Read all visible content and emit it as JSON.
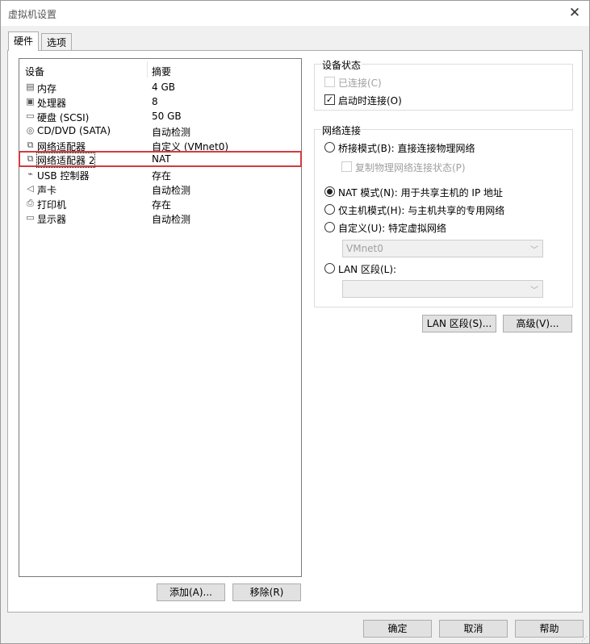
{
  "window": {
    "title": "虚拟机设置"
  },
  "tabs": [
    {
      "label": "硬件"
    },
    {
      "label": "选项"
    }
  ],
  "device_list": {
    "headers": {
      "device": "设备",
      "summary": "摘要"
    },
    "rows": [
      {
        "icon": "memory-icon",
        "name": "内存",
        "summary": "4 GB"
      },
      {
        "icon": "processor-icon",
        "name": "处理器",
        "summary": "8"
      },
      {
        "icon": "hard-disk-icon",
        "name": "硬盘 (SCSI)",
        "summary": "50 GB"
      },
      {
        "icon": "cd-dvd-icon",
        "name": "CD/DVD (SATA)",
        "summary": "自动检测"
      },
      {
        "icon": "network-adapter-icon",
        "name": "网络适配器",
        "summary": "自定义 (VMnet0)"
      },
      {
        "icon": "network-adapter-icon",
        "name": "网络适配器 2",
        "summary": "NAT"
      },
      {
        "icon": "usb-icon",
        "name": "USB 控制器",
        "summary": "存在"
      },
      {
        "icon": "sound-icon",
        "name": "声卡",
        "summary": "自动检测"
      },
      {
        "icon": "printer-icon",
        "name": "打印机",
        "summary": "存在"
      },
      {
        "icon": "display-icon",
        "name": "显示器",
        "summary": "自动检测"
      }
    ],
    "selected_index": 5,
    "highlight_color": "#d23c3c"
  },
  "list_buttons": {
    "add": "添加(A)...",
    "remove": "移除(R)"
  },
  "device_status": {
    "title": "设备状态",
    "connected": {
      "label": "已连接(C)",
      "checked": false,
      "enabled": false
    },
    "connect_at_power_on": {
      "label": "启动时连接(O)",
      "checked": true,
      "enabled": true
    }
  },
  "network": {
    "title": "网络连接",
    "bridged": {
      "label": "桥接模式(B): 直接连接物理网络",
      "selected": false
    },
    "replicate": {
      "label": "复制物理网络连接状态(P)",
      "checked": false,
      "enabled": false
    },
    "nat": {
      "label": "NAT 模式(N): 用于共享主机的 IP 地址",
      "selected": true
    },
    "host_only": {
      "label": "仅主机模式(H): 与主机共享的专用网络",
      "selected": false
    },
    "custom": {
      "label": "自定义(U): 特定虚拟网络",
      "selected": false
    },
    "custom_select": {
      "value": "VMnet0",
      "enabled": false
    },
    "lan": {
      "label": "LAN 区段(L):",
      "selected": false
    },
    "lan_select": {
      "value": "",
      "enabled": false
    }
  },
  "net_buttons": {
    "lan_segments": "LAN 区段(S)...",
    "advanced": "高级(V)..."
  },
  "footer": {
    "ok": "确定",
    "cancel": "取消",
    "help": "帮助"
  }
}
